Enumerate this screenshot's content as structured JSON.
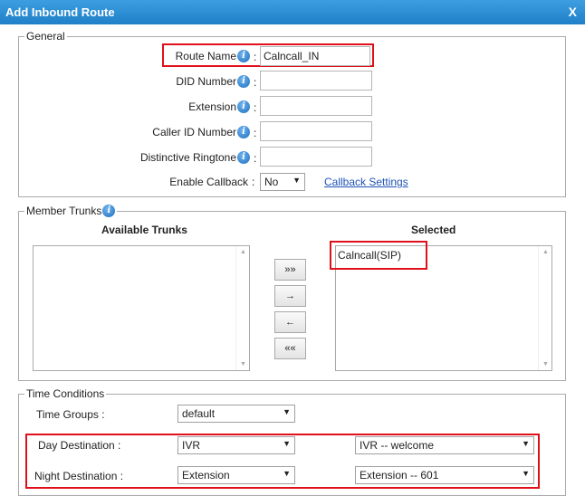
{
  "dialog": {
    "title": "Add Inbound Route",
    "close_label": "X"
  },
  "general": {
    "legend": "General",
    "route_name_label": "Route Name",
    "route_name_value": "Calncall_IN",
    "did_number_label": "DID Number",
    "did_number_value": "",
    "extension_label": "Extension",
    "extension_value": "",
    "caller_id_label": "Caller ID Number",
    "caller_id_value": "",
    "ringtone_label": "Distinctive Ringtone",
    "ringtone_value": "",
    "callback_label": "Enable Callback",
    "callback_value": "No",
    "callback_settings_link": "Callback Settings",
    "colon": ":",
    "info_glyph": "i"
  },
  "trunks": {
    "legend": "Member Trunks",
    "available_header": "Available Trunks",
    "selected_header": "Selected",
    "available_items": [],
    "selected_items": [
      "Calncall(SIP)"
    ],
    "buttons": {
      "add_all": "»»",
      "add_one": "→",
      "remove_one": "←",
      "remove_all": "««"
    },
    "scroll_up": "▲",
    "scroll_down": "▼"
  },
  "time_conditions": {
    "legend": "Time Conditions",
    "time_groups_label": "Time Groups :",
    "time_groups_value": "default",
    "day_dest_label": "Day Destination :",
    "day_dest_type": "IVR",
    "day_dest_target": "IVR -- welcome",
    "night_dest_label": "Night Destination :",
    "night_dest_type": "Extension",
    "night_dest_target": "Extension -- 601",
    "dropdown_arrow": "▼"
  },
  "colors": {
    "titlebar": "#2a8ad4",
    "highlight": "#e0101a",
    "link": "#1f53b5"
  }
}
